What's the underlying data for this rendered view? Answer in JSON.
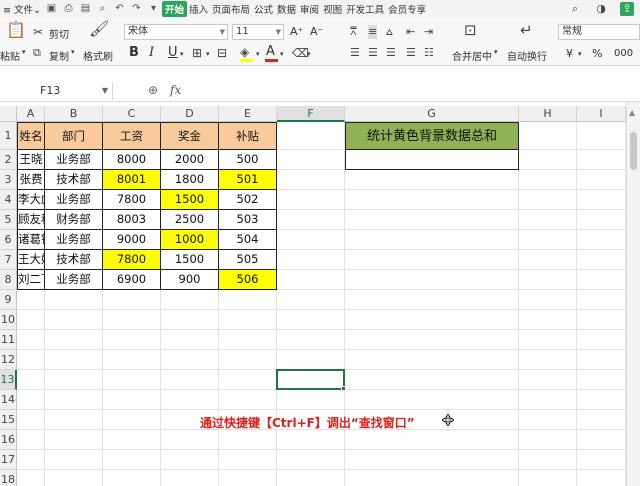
{
  "menubar": {
    "file": "文件",
    "file_arrow": "⌄",
    "tabs": [
      {
        "label": "开始",
        "active": true
      },
      {
        "label": "插入",
        "active": false
      },
      {
        "label": "页面布局",
        "active": false
      },
      {
        "label": "公式",
        "active": false
      },
      {
        "label": "数据",
        "active": false
      },
      {
        "label": "审阅",
        "active": false
      },
      {
        "label": "视图",
        "active": false
      },
      {
        "label": "开发工具",
        "active": false
      },
      {
        "label": "会员专享",
        "active": false
      }
    ],
    "accent": "#2aa45f"
  },
  "ribbon": {
    "paste": "粘贴",
    "cut": "剪切",
    "copy": "复制",
    "format_painter": "格式刷",
    "font_name": "宋体",
    "font_size": "11",
    "font_grow": "A⁺",
    "font_shrink": "A⁻",
    "bold": "B",
    "italic": "I",
    "underline": "U",
    "font_color_letter": "A",
    "merge_center": "合并居中",
    "wrap_text": "自动换行",
    "number_format": "常规",
    "currency": "¥",
    "percent": "%",
    "thousands": "000"
  },
  "formula_bar": {
    "cell_ref": "F13",
    "fx": "fx",
    "content": ""
  },
  "columns": [
    "A",
    "B",
    "C",
    "D",
    "E",
    "F",
    "G",
    "H",
    "I"
  ],
  "selected_column": "F",
  "rows": [
    "1",
    "2",
    "3",
    "4",
    "5",
    "6",
    "7",
    "8",
    "9",
    "10",
    "11",
    "12",
    "13",
    "14",
    "15",
    "16",
    "17",
    "18"
  ],
  "selected_row": "13",
  "table": {
    "headers": [
      "姓名",
      "部门",
      "工资",
      "奖金",
      "补贴"
    ],
    "rows": [
      [
        "王晓",
        "业务部",
        "8000",
        "2000",
        "500"
      ],
      [
        "张费",
        "技术部",
        "8001",
        "1800",
        "501"
      ],
      [
        "李大彪",
        "业务部",
        "7800",
        "1500",
        "502"
      ],
      [
        "顾友秋",
        "财务部",
        "8003",
        "2500",
        "503"
      ],
      [
        "诸葛镇",
        "业务部",
        "9000",
        "1000",
        "504"
      ],
      [
        "王大妞",
        "技术部",
        "7800",
        "1500",
        "505"
      ],
      [
        "刘二飞",
        "业务部",
        "6900",
        "900",
        "506"
      ]
    ],
    "highlight": [
      [
        false,
        false,
        false,
        false,
        false
      ],
      [
        false,
        false,
        true,
        false,
        true
      ],
      [
        false,
        false,
        false,
        true,
        false
      ],
      [
        false,
        false,
        false,
        false,
        false
      ],
      [
        false,
        false,
        false,
        true,
        false
      ],
      [
        false,
        false,
        true,
        false,
        false
      ],
      [
        false,
        false,
        false,
        false,
        true
      ]
    ],
    "header_color": "#f9cb9c",
    "highlight_color": "#ffff00"
  },
  "summary": {
    "title": "统计黄色背景数据总和",
    "value": "",
    "title_color": "#8fb255"
  },
  "caption": "通过快捷键【Ctrl+F】调出“查找窗口”",
  "caption_color": "#e0201b"
}
